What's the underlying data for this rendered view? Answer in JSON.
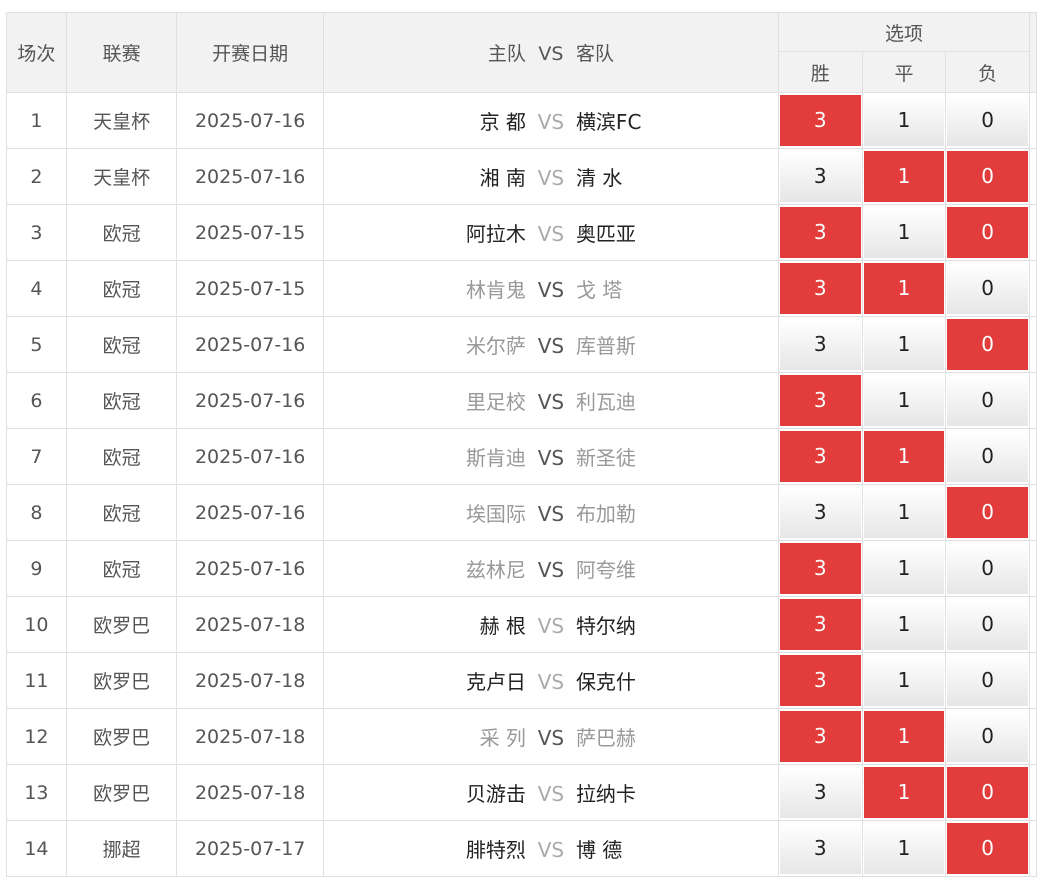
{
  "header": {
    "col_no": "场次",
    "col_league": "联赛",
    "col_date": "开赛日期",
    "col_home": "主队",
    "col_vs": "VS",
    "col_away": "客队",
    "options_title": "选项",
    "opt_win": "胜",
    "opt_draw": "平",
    "opt_lose": "负"
  },
  "rows": [
    {
      "no": "1",
      "league": "天皇杯",
      "date": "2025-07-16",
      "home": "京 都",
      "vs": "VS",
      "away": "横滨FC",
      "win": "3",
      "draw": "1",
      "lose": "0",
      "win_sel": true,
      "draw_sel": false,
      "lose_sel": false,
      "style": "dark"
    },
    {
      "no": "2",
      "league": "天皇杯",
      "date": "2025-07-16",
      "home": "湘 南",
      "vs": "VS",
      "away": "清 水",
      "win": "3",
      "draw": "1",
      "lose": "0",
      "win_sel": false,
      "draw_sel": true,
      "lose_sel": true,
      "style": "dark"
    },
    {
      "no": "3",
      "league": "欧冠",
      "date": "2025-07-15",
      "home": "阿拉木",
      "vs": "VS",
      "away": "奥匹亚",
      "win": "3",
      "draw": "1",
      "lose": "0",
      "win_sel": true,
      "draw_sel": false,
      "lose_sel": true,
      "style": "dark"
    },
    {
      "no": "4",
      "league": "欧冠",
      "date": "2025-07-15",
      "home": "林肯鬼",
      "vs": "VS",
      "away": "戈 塔",
      "win": "3",
      "draw": "1",
      "lose": "0",
      "win_sel": true,
      "draw_sel": true,
      "lose_sel": false,
      "style": "light"
    },
    {
      "no": "5",
      "league": "欧冠",
      "date": "2025-07-16",
      "home": "米尔萨",
      "vs": "VS",
      "away": "库普斯",
      "win": "3",
      "draw": "1",
      "lose": "0",
      "win_sel": false,
      "draw_sel": false,
      "lose_sel": true,
      "style": "light"
    },
    {
      "no": "6",
      "league": "欧冠",
      "date": "2025-07-16",
      "home": "里足校",
      "vs": "VS",
      "away": "利瓦迪",
      "win": "3",
      "draw": "1",
      "lose": "0",
      "win_sel": true,
      "draw_sel": false,
      "lose_sel": false,
      "style": "light"
    },
    {
      "no": "7",
      "league": "欧冠",
      "date": "2025-07-16",
      "home": "斯肯迪",
      "vs": "VS",
      "away": "新圣徒",
      "win": "3",
      "draw": "1",
      "lose": "0",
      "win_sel": true,
      "draw_sel": true,
      "lose_sel": false,
      "style": "light"
    },
    {
      "no": "8",
      "league": "欧冠",
      "date": "2025-07-16",
      "home": "埃国际",
      "vs": "VS",
      "away": "布加勒",
      "win": "3",
      "draw": "1",
      "lose": "0",
      "win_sel": false,
      "draw_sel": false,
      "lose_sel": true,
      "style": "light"
    },
    {
      "no": "9",
      "league": "欧冠",
      "date": "2025-07-16",
      "home": "兹林尼",
      "vs": "VS",
      "away": "阿夸维",
      "win": "3",
      "draw": "1",
      "lose": "0",
      "win_sel": true,
      "draw_sel": false,
      "lose_sel": false,
      "style": "light"
    },
    {
      "no": "10",
      "league": "欧罗巴",
      "date": "2025-07-18",
      "home": "赫 根",
      "vs": "VS",
      "away": "特尔纳",
      "win": "3",
      "draw": "1",
      "lose": "0",
      "win_sel": true,
      "draw_sel": false,
      "lose_sel": false,
      "style": "dark"
    },
    {
      "no": "11",
      "league": "欧罗巴",
      "date": "2025-07-18",
      "home": "克卢日",
      "vs": "VS",
      "away": "保克什",
      "win": "3",
      "draw": "1",
      "lose": "0",
      "win_sel": true,
      "draw_sel": false,
      "lose_sel": false,
      "style": "dark"
    },
    {
      "no": "12",
      "league": "欧罗巴",
      "date": "2025-07-18",
      "home": "采 列",
      "vs": "VS",
      "away": "萨巴赫",
      "win": "3",
      "draw": "1",
      "lose": "0",
      "win_sel": true,
      "draw_sel": true,
      "lose_sel": false,
      "style": "light"
    },
    {
      "no": "13",
      "league": "欧罗巴",
      "date": "2025-07-18",
      "home": "贝游击",
      "vs": "VS",
      "away": "拉纳卡",
      "win": "3",
      "draw": "1",
      "lose": "0",
      "win_sel": false,
      "draw_sel": true,
      "lose_sel": true,
      "style": "dark"
    },
    {
      "no": "14",
      "league": "挪超",
      "date": "2025-07-17",
      "home": "腓特烈",
      "vs": "VS",
      "away": "博 德",
      "win": "3",
      "draw": "1",
      "lose": "0",
      "win_sel": false,
      "draw_sel": false,
      "lose_sel": true,
      "style": "dark"
    }
  ]
}
